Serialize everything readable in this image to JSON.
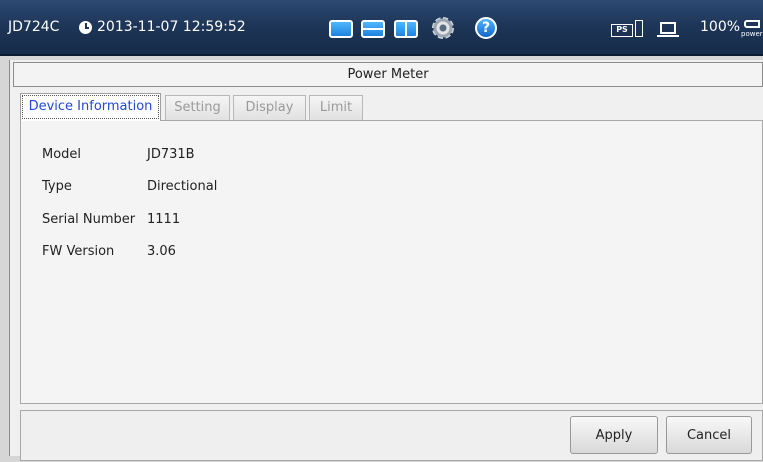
{
  "status_bar": {
    "model": "JD724C",
    "datetime": "2013-11-07 12:59:52",
    "battery_percent": "100%",
    "ps_label": "PS",
    "power_label": "power",
    "icons": [
      "clock-icon",
      "layout-single-icon",
      "layout-split-horizontal-icon",
      "layout-split-vertical-icon",
      "settings-gear-icon",
      "help-icon",
      "ps-usb-icon",
      "laptop-icon",
      "power-icon"
    ],
    "accent_color": "#1e3658"
  },
  "window": {
    "title": "Power Meter"
  },
  "tabs": [
    {
      "label": "Device Information",
      "active": true
    },
    {
      "label": "Setting",
      "active": false
    },
    {
      "label": "Display",
      "active": false
    },
    {
      "label": "Limit",
      "active": false
    }
  ],
  "device_info": [
    {
      "label": "Model",
      "value": "JD731B"
    },
    {
      "label": "Type",
      "value": "Directional"
    },
    {
      "label": "Serial Number",
      "value": "1111"
    },
    {
      "label": "FW Version",
      "value": "3.06"
    }
  ],
  "buttons": {
    "apply": "Apply",
    "cancel": "Cancel"
  },
  "colors": {
    "active_tab_text": "#2248d6",
    "inactive_tab_text": "#9a9a9a"
  }
}
